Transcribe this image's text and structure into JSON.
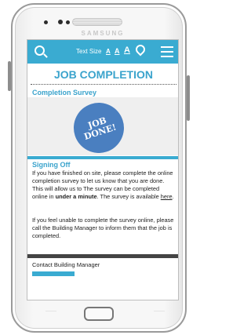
{
  "device": {
    "brand": "SAMSUNG"
  },
  "appbar": {
    "text_size_label": "Text Size",
    "text_size_options": [
      "A",
      "A",
      "A"
    ]
  },
  "page": {
    "title": "JOB COMPLETION",
    "section_heading": "Completion Survey",
    "hero_text": "JOB DONE!"
  },
  "signoff": {
    "heading": "Signing Off",
    "para1_a": "If you have finished on site, please complete the online completion survey to let us know that you are done. This will allow us to The survey can be completed online in ",
    "para1_bold": "under a minute",
    "para1_b": ". The survey is available ",
    "para1_link": "here",
    "para1_end": ".",
    "para2": "If you feel unable to complete the survey online, please call the Building Manager to inform them that the job is completed."
  },
  "contact": {
    "label": "Contact Building Manager"
  },
  "colors": {
    "accent": "#3aabd1",
    "hero": "#4a7fc0"
  }
}
